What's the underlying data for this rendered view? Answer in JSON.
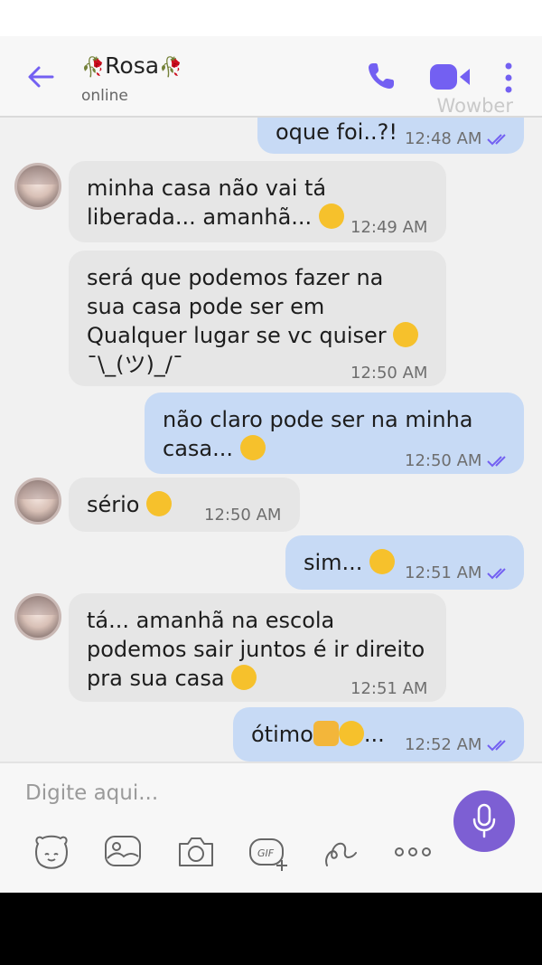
{
  "header": {
    "contact_name": "Rosa",
    "status": "online",
    "watermark": "Wowber",
    "accent": "#7360f2"
  },
  "messages": [
    {
      "dir": "out",
      "text": "oque foi..?!",
      "time": "12:48 AM"
    },
    {
      "dir": "in",
      "text": "minha casa não vai tá liberada... amanhã...",
      "emoji": "anguished-face",
      "time": "12:49 AM"
    },
    {
      "dir": "in",
      "text": "será que podemos fazer na sua casa pode ser em Qualquer lugar se vc quiser",
      "emoji": "anguished-face",
      "text_after": "¯\\_(ツ)_/¯",
      "time": "12:50 AM"
    },
    {
      "dir": "out",
      "text": "não claro pode ser na minha casa...",
      "emoji": "grinning-face",
      "time": "12:50 AM"
    },
    {
      "dir": "in",
      "text": "sério",
      "emoji": "surprised-face",
      "time": "12:50 AM"
    },
    {
      "dir": "out",
      "text": "sim...",
      "emoji": "grinning-face",
      "time": "12:51 AM"
    },
    {
      "dir": "in",
      "text": "tá... amanhã na escola podemos sair juntos é ir direito pra sua casa",
      "emoji": "smiling-face",
      "time": "12:51 AM"
    },
    {
      "dir": "out",
      "text": "ótimo",
      "emoji": "thumbs-up grinning-face",
      "text_after": "...",
      "time": "12:52 AM"
    }
  ],
  "composer": {
    "placeholder": "Digite aqui...",
    "tools": [
      "sticker-icon",
      "image-icon",
      "camera-icon",
      "gif-icon",
      "doodle-icon",
      "more-icon"
    ],
    "mic_color": "#7d5fd3"
  }
}
